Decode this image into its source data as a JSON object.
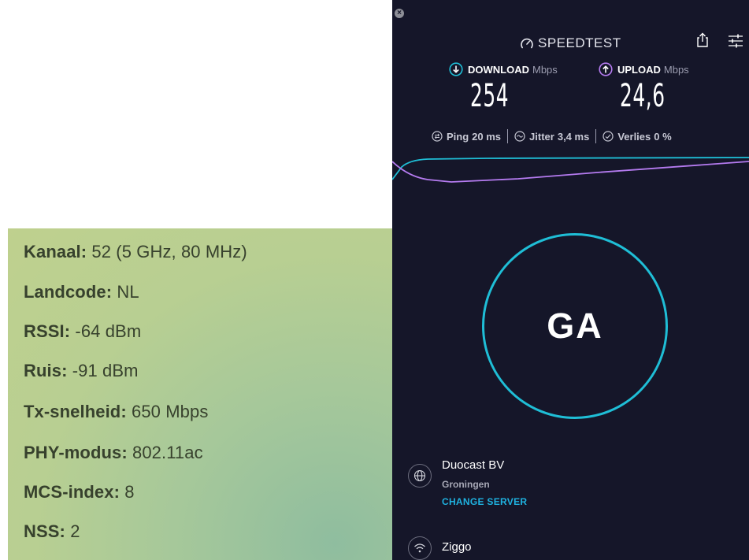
{
  "wifi": {
    "rows": [
      {
        "label": "Kanaal:",
        "value": "52 (5 GHz, 80 MHz)"
      },
      {
        "label": "Landcode:",
        "value": "NL"
      },
      {
        "label": "RSSI:",
        "value": "-64 dBm"
      },
      {
        "label": "Ruis:",
        "value": "-91 dBm"
      },
      {
        "label": "Tx-snelheid:",
        "value": "650 Mbps"
      },
      {
        "label": "PHY-modus:",
        "value": "802.11ac"
      },
      {
        "label": "MCS-index:",
        "value": "8"
      },
      {
        "label": "NSS:",
        "value": "2"
      }
    ]
  },
  "speedtest": {
    "logo": "SPEEDTEST",
    "download": {
      "label": "DOWNLOAD",
      "unit": "Mbps",
      "value": "254",
      "color": "#1fbed6"
    },
    "upload": {
      "label": "UPLOAD",
      "unit": "Mbps",
      "value": "24,6",
      "color": "#b57bf0"
    },
    "stats": {
      "ping_label": "Ping",
      "ping_value": "20 ms",
      "jitter_label": "Jitter",
      "jitter_value": "3,4 ms",
      "loss_label": "Verlies",
      "loss_value": "0 %"
    },
    "go_label": "GA",
    "server": {
      "name": "Duocast BV",
      "city": "Groningen",
      "change": "CHANGE SERVER"
    },
    "isp": {
      "name": "Ziggo"
    },
    "icons": [
      "close-icon",
      "speedometer-icon",
      "share-icon",
      "settings-sliders-icon",
      "download-arrow-icon",
      "upload-arrow-icon",
      "ping-icon",
      "jitter-icon",
      "packet-loss-icon",
      "globe-icon",
      "wifi-icon"
    ]
  }
}
